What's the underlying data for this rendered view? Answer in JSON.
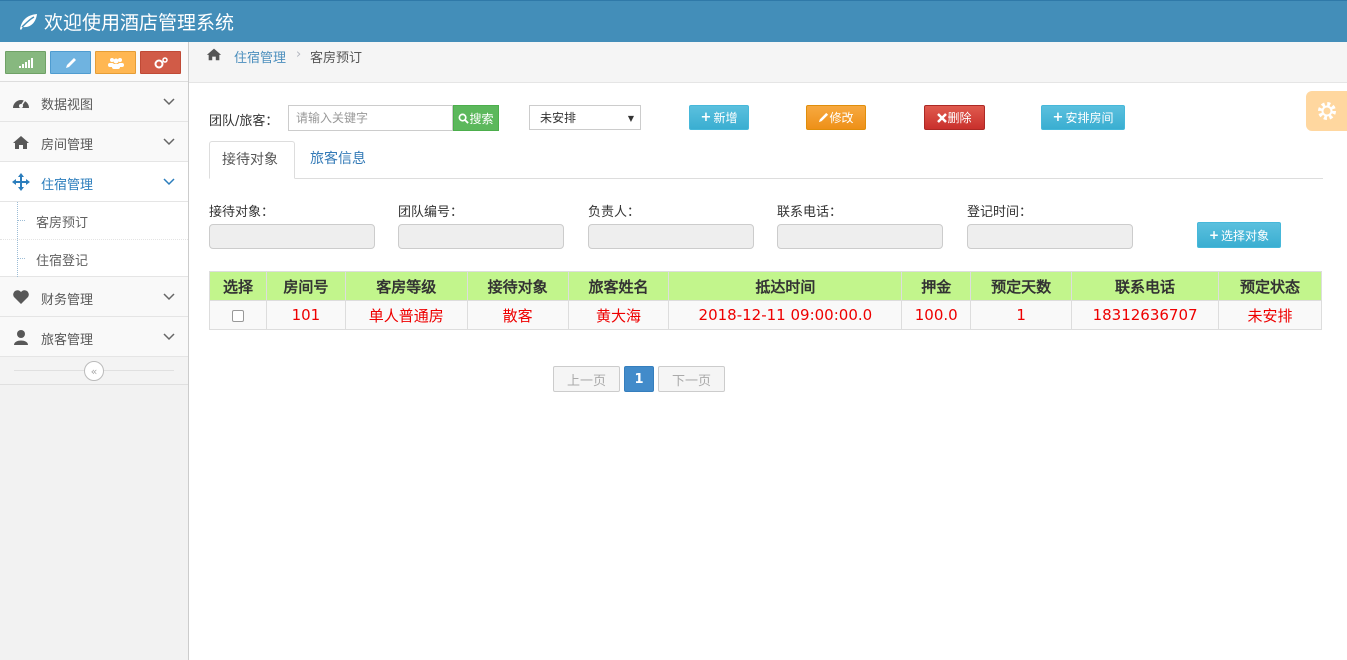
{
  "header": {
    "title": "欢迎使用酒店管理系统"
  },
  "colors": {
    "header_bg": "#438eb9",
    "accent_green": "#c2f58c",
    "table_text": "#e00000"
  },
  "sidebar": {
    "shortcuts": [
      {
        "icon": "signal-icon"
      },
      {
        "icon": "pencil-icon"
      },
      {
        "icon": "users-icon"
      },
      {
        "icon": "cogs-icon"
      }
    ],
    "items": [
      {
        "label": "数据视图",
        "icon": "dashboard-icon"
      },
      {
        "label": "房间管理",
        "icon": "home-icon"
      },
      {
        "label": "住宿管理",
        "icon": "move-icon",
        "active": true
      },
      {
        "label": "财务管理",
        "icon": "heart-icon"
      },
      {
        "label": "旅客管理",
        "icon": "user-icon"
      }
    ],
    "submenu": [
      {
        "label": "客房预订"
      },
      {
        "label": "住宿登记"
      }
    ]
  },
  "breadcrumb": {
    "parent": "住宿管理",
    "current": "客房预订"
  },
  "toolbar": {
    "search_label": "团队/旅客：",
    "search_placeholder": "请输入关键字",
    "search_button": "搜索",
    "status_select": "未安排",
    "new_button": "新增",
    "edit_button": "修改",
    "delete_button": "删除",
    "arrange_button": "安排房间"
  },
  "tabs": [
    {
      "label": "接待对象",
      "active": true
    },
    {
      "label": "旅客信息",
      "active": false
    }
  ],
  "form": {
    "fields": [
      "接待对象：",
      "团队编号：",
      "负责人：",
      "联系电话：",
      "登记时间："
    ],
    "choose_button": "选择对象"
  },
  "table": {
    "headers": [
      "选择",
      "房间号",
      "客房等级",
      "接待对象",
      "旅客姓名",
      "抵达时间",
      "押金",
      "预定天数",
      "联系电话",
      "预定状态"
    ],
    "rows": [
      [
        "",
        "101",
        "单人普通房",
        "散客",
        "黄大海",
        "2018-12-11 09:00:00.0",
        "100.0",
        "1",
        "18312636707",
        "未安排"
      ]
    ]
  },
  "pager": {
    "prev": "上一页",
    "page": "1",
    "next": "下一页"
  }
}
